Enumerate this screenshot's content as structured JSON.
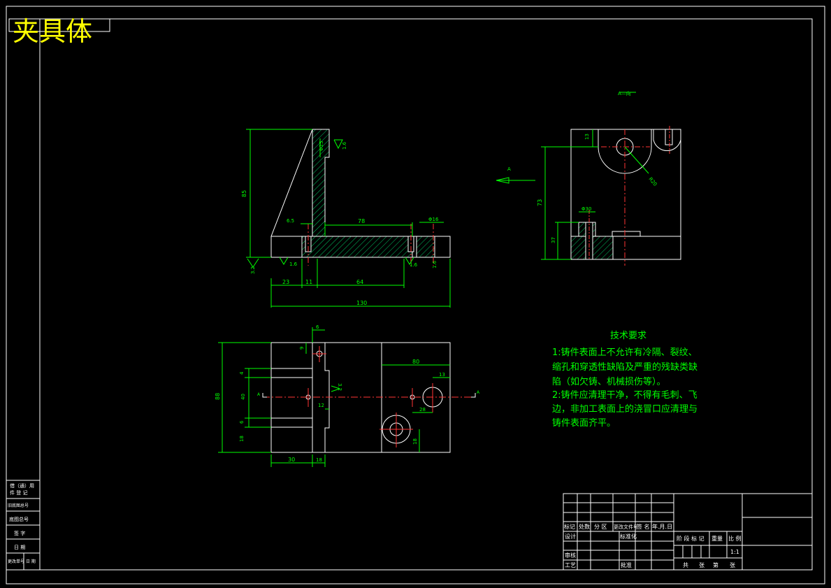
{
  "title": "夹具体",
  "view_label": "A—向",
  "arrow_label": "A",
  "section_mark": "A",
  "tech": {
    "heading": "技术要求",
    "lines": [
      "1:铸件表面上不允许有冷隔、裂纹、",
      "缩孔和穿透性缺陷及严重的残缺类缺",
      "陷（如欠铸、机械损伤等）。",
      "2:铸件应清理干净，不得有毛刺、飞",
      "边，非加工表面上的浇冒口应清理与",
      "铸件表面齐平。"
    ]
  },
  "dims": {
    "d_85": "85",
    "d_65": "6.5",
    "d_78": "78",
    "d_16": "Φ16",
    "d_23": "23",
    "d_11": "11",
    "d_64": "64",
    "d_130": "130",
    "d_phi25": "Φ25",
    "d_r1_6a": "1.6",
    "d_r1_6b": "1.6",
    "d_r1_6c": "1.6",
    "d_r1_6d": "1.6",
    "d_r3_2": "3.2",
    "s_13": "13",
    "s_R20": "R20",
    "s_73": "73",
    "s_phi30": "Φ30",
    "s_37": "37",
    "p_6": "6",
    "p_9": "9",
    "p_80": "80",
    "p_13": "13",
    "p_88": "88",
    "p_4a": "4",
    "p_40": "40",
    "p_6b": "6",
    "p_12": "12",
    "p_18": "18",
    "p_30": "30",
    "p_18b": "18",
    "p_28": "28",
    "p_18c": "18",
    "p_r3_2": "3.2"
  },
  "title_block": {
    "row_labels": [
      "标记",
      "处数",
      "分 区",
      "更改文件号",
      "签 名",
      "年.月.日"
    ],
    "design": "设计",
    "standard": "标准化",
    "review": "审核",
    "process": "工艺",
    "approve": "批准",
    "stage_labels": [
      "阶 段 标 记",
      "重量",
      "比 例"
    ],
    "scale": "1:1",
    "sheet": [
      "共",
      "张",
      "第",
      "张"
    ]
  },
  "side_table": {
    "rows": [
      "借（通）用",
      "件 登 记",
      "旧底图总号",
      "底图总号",
      "签 字",
      "日 期",
      "更改单号",
      "日 期"
    ]
  }
}
